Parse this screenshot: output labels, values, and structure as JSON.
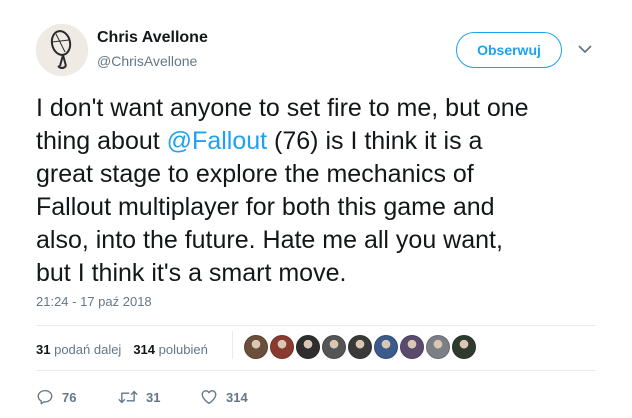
{
  "author": {
    "name": "Chris Avellone",
    "handle": "@ChrisAvellone",
    "avatar_icon": "tennis-racket-avatar"
  },
  "follow_button": {
    "label": "Obserwuj"
  },
  "menu_icon": "chevron-down-icon",
  "tweet": {
    "lines": [
      {
        "text": "I don't want anyone to set fire to me, but one"
      },
      {
        "before": "thing about ",
        "mention": "@Fallout",
        "after": " (76) is I think it is a"
      },
      {
        "text": "great stage to explore the mechanics of"
      },
      {
        "text": "Fallout multiplayer for both this game and"
      },
      {
        "text": "also, into the future. Hate me all you want,"
      },
      {
        "text": "but I think it's a smart move."
      }
    ]
  },
  "timestamp": "21:24 - 17 paź 2018",
  "stats": {
    "retweets_count": "31",
    "retweets_label": "podań dalej",
    "likes_count": "314",
    "likes_label": "polubień"
  },
  "likers": [
    {
      "name": "liker-avatar-1",
      "color": "#6b4f3a"
    },
    {
      "name": "liker-avatar-2",
      "color": "#8a3b2f"
    },
    {
      "name": "liker-avatar-3",
      "color": "#2e2e2e"
    },
    {
      "name": "liker-avatar-4",
      "color": "#555555"
    },
    {
      "name": "liker-avatar-5",
      "color": "#3a3a3a"
    },
    {
      "name": "liker-avatar-6",
      "color": "#3b5b8c"
    },
    {
      "name": "liker-avatar-7",
      "color": "#5a4a6e"
    },
    {
      "name": "liker-avatar-8",
      "color": "#7c7f86"
    },
    {
      "name": "liker-avatar-9",
      "color": "#2f3b2f"
    }
  ],
  "actions": {
    "reply": {
      "icon": "reply-icon",
      "count": "76"
    },
    "retweet": {
      "icon": "retweet-icon",
      "count": "31"
    },
    "like": {
      "icon": "heart-icon",
      "count": "314"
    }
  },
  "colors": {
    "accent": "#1da1f2",
    "secondary_text": "#657786",
    "primary_text": "#14171a",
    "divider": "#e6ecf0"
  }
}
